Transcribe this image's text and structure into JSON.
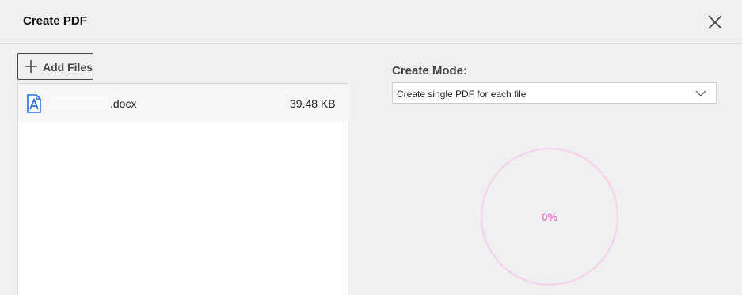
{
  "dialog": {
    "title": "Create PDF"
  },
  "toolbar": {
    "add_files_label": "Add Files"
  },
  "files": [
    {
      "name": ".docx",
      "size": "39.48 KB"
    }
  ],
  "create_mode": {
    "label": "Create Mode:",
    "selected": "Create single PDF for each file"
  },
  "progress": {
    "value": 0,
    "text": "0%"
  },
  "colors": {
    "background": "#f0f0f0",
    "progress_ring": "#f3d6ec",
    "progress_text": "#e27fcf",
    "file_icon": "#2c6fd6"
  },
  "icons": {
    "close": "close-icon",
    "add": "plus-icon",
    "file": "document-icon",
    "dropdown": "chevron-down-icon"
  }
}
